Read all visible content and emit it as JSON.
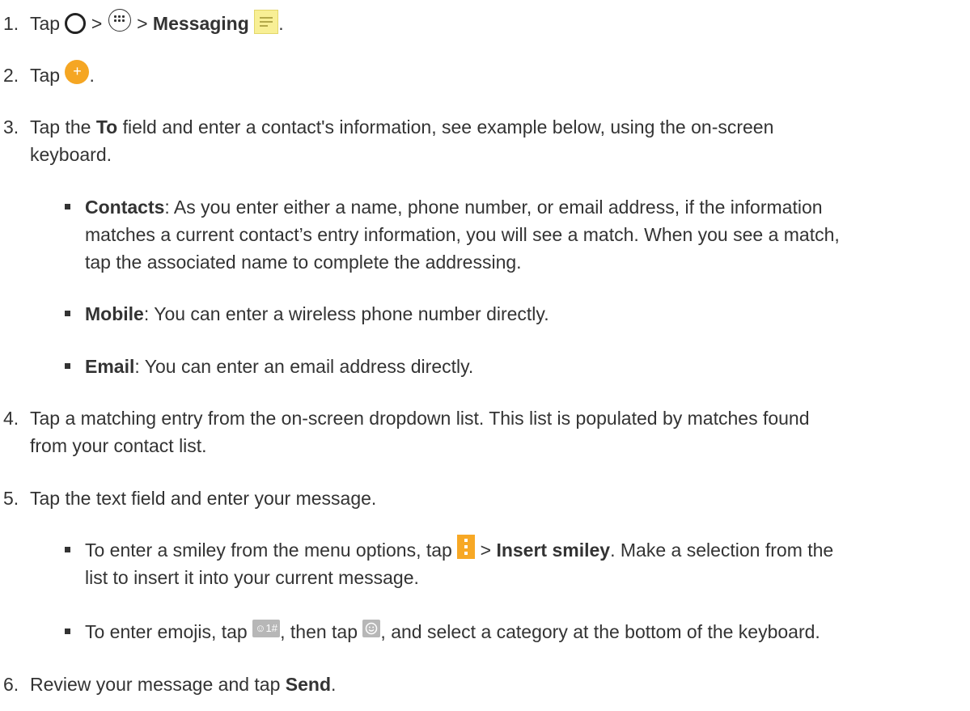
{
  "steps": [
    {
      "number": "1.",
      "parts": [
        "Tap",
        ">",
        ">",
        "Messaging",
        "."
      ]
    },
    {
      "number": "2.",
      "parts": [
        "Tap",
        "."
      ]
    },
    {
      "number": "3.",
      "parts": [
        "Tap the ",
        "To",
        " field and enter a contact's information, see example below, using the on-screen",
        "keyboard."
      ]
    },
    {
      "number": "4.",
      "parts": [
        "Tap a matching entry from the on-screen dropdown list. This list is populated by matches found",
        "from your contact list."
      ]
    },
    {
      "number": "5.",
      "parts": [
        "Tap the text field and enter your message."
      ]
    },
    {
      "number": "6.",
      "parts": [
        "Review your message and tap ",
        "Send",
        "."
      ]
    }
  ],
  "bullets": [
    {
      "term": "Contacts",
      "lines": [
        ": As you enter either a name, phone number, or email address, if the information",
        "matches a current contact’s entry information, you will see a match. When you see a match,",
        "tap the associated name to complete the addressing."
      ]
    },
    {
      "term": "Mobile",
      "lines": [
        ": You can enter a wireless phone number directly."
      ]
    },
    {
      "term": "Email",
      "lines": [
        ": You can enter an email address directly."
      ]
    },
    {
      "parts": [
        "To enter a smiley from the menu options, tap",
        ">",
        "Insert smiley",
        ". Make a selection from the",
        "list to insert it into your current message."
      ]
    },
    {
      "parts": [
        "To enter emojis, tap",
        ", then tap",
        ", and select a category at the bottom of the keyboard."
      ]
    }
  ],
  "icons": {
    "home": "home-circle-icon",
    "apps": "apps-grid-icon",
    "messaging": "messaging-icon",
    "compose": "compose-plus-icon",
    "menu": "menu-dots-icon",
    "symbols": "symbols-key-icon",
    "symbols_label": "☺1#",
    "smiley": "smiley-key-icon"
  },
  "colors": {
    "accent": "#f5a623",
    "text": "#333333",
    "messaging_bg": "#f8ef95"
  }
}
